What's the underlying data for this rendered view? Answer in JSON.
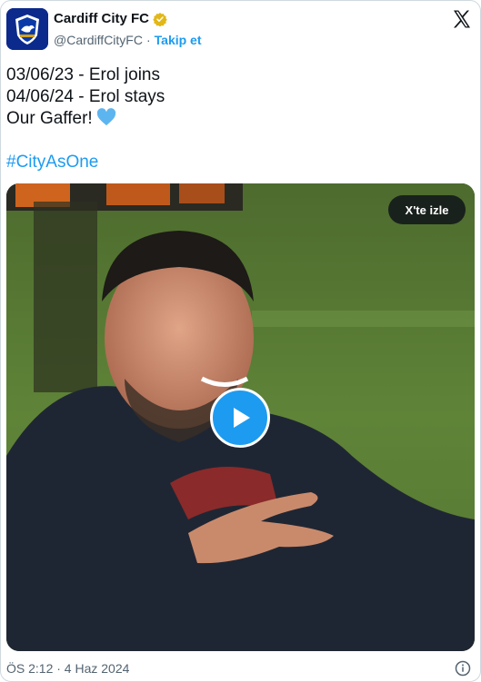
{
  "account": {
    "name": "Cardiff City FC",
    "handle": "@CardiffCityFC",
    "separator": "·",
    "follow_label": "Takip et",
    "verified_icon": "gold-verified-badge-icon",
    "avatar_icon": "cardiff-city-crest"
  },
  "tweet": {
    "lines": [
      "03/06/23 - Erol joins",
      "04/06/24 - Erol stays",
      "Our Gaffer!"
    ],
    "emoji": "light-blue-heart-icon",
    "hashtag": "#CityAsOne"
  },
  "video": {
    "watch_label": "X'te izle",
    "play_icon": "play-icon"
  },
  "footer": {
    "timestamp": "ÖS 2:12 · 4 Haz 2024",
    "info_icon": "info-icon"
  },
  "colors": {
    "accent": "#1d9bf0",
    "heart": "#5db5f0",
    "text": "#0f1419",
    "muted": "#536471",
    "avatar_bg": "#0b2a8c"
  }
}
